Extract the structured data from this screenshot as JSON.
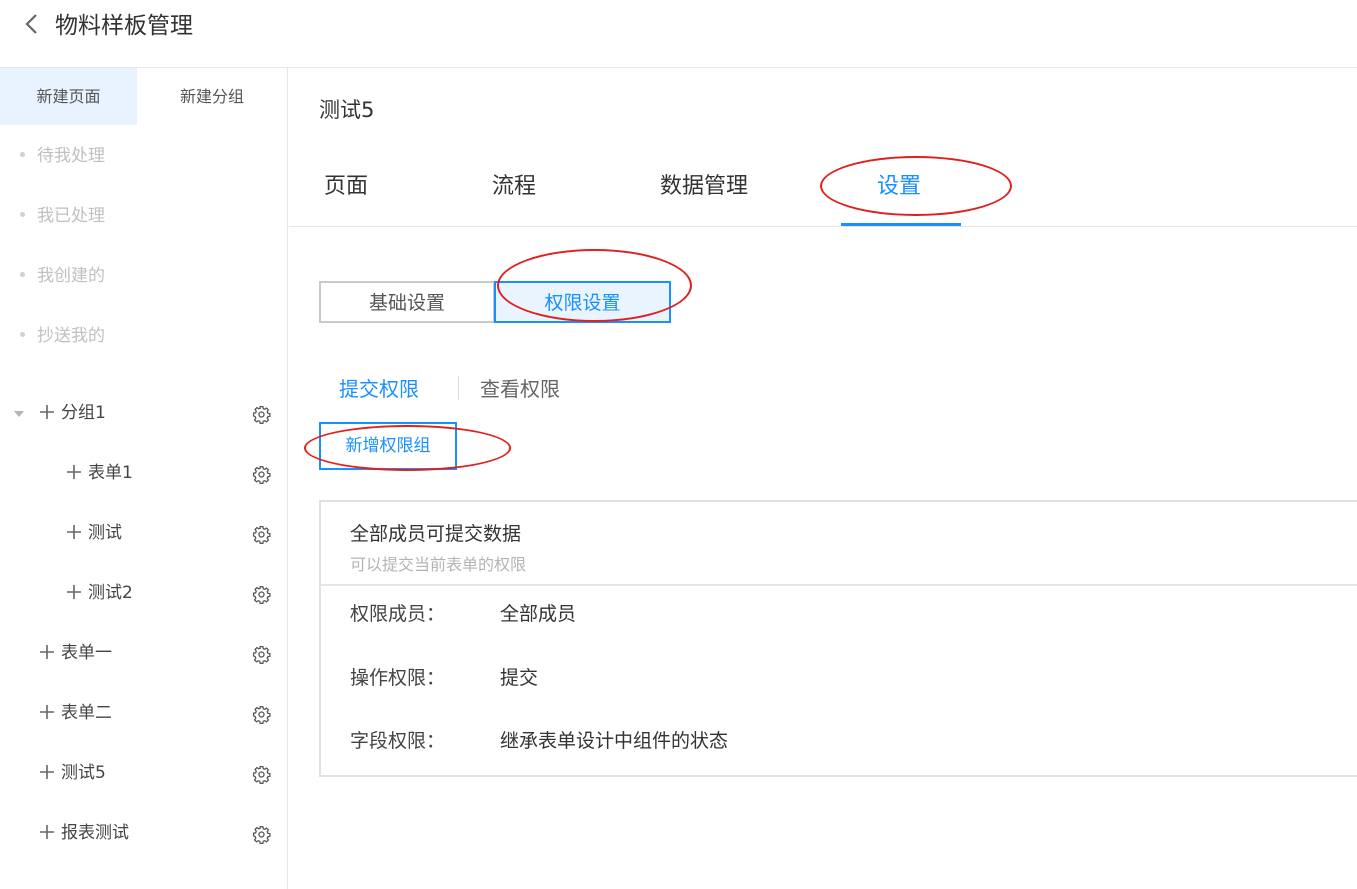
{
  "header": {
    "title": "物料样板管理",
    "back_icon": "chevron-left-icon"
  },
  "sidebar": {
    "tabs": [
      {
        "label": "新建页面",
        "active": true
      },
      {
        "label": "新建分组",
        "active": false
      }
    ],
    "quick_items": [
      "待我处理",
      "我已处理",
      "我创建的",
      "抄送我的"
    ],
    "tree": [
      {
        "label": "分组1",
        "level": 0,
        "expanded": true,
        "has_caret": true
      },
      {
        "label": "表单1",
        "level": 1
      },
      {
        "label": "测试",
        "level": 1
      },
      {
        "label": "测试2",
        "level": 1
      },
      {
        "label": "表单一",
        "level": 0
      },
      {
        "label": "表单二",
        "level": 0
      },
      {
        "label": "测试5",
        "level": 0
      },
      {
        "label": "报表测试",
        "level": 0
      }
    ]
  },
  "main": {
    "page_title": "测试5",
    "tabs": [
      {
        "label": "页面",
        "active": false
      },
      {
        "label": "流程",
        "active": false
      },
      {
        "label": "数据管理",
        "active": false
      },
      {
        "label": "设置",
        "active": true
      }
    ],
    "segments": [
      {
        "label": "基础设置",
        "active": false
      },
      {
        "label": "权限设置",
        "active": true
      }
    ],
    "sub_tabs": [
      {
        "label": "提交权限",
        "active": true
      },
      {
        "label": "查看权限",
        "active": false
      }
    ],
    "add_button": "新增权限组",
    "permission_card": {
      "title": "全部成员可提交数据",
      "description": "可以提交当前表单的权限",
      "rows": [
        {
          "label": "权限成员：",
          "value": "全部成员"
        },
        {
          "label": "操作权限：",
          "value": "提交"
        },
        {
          "label": "字段权限：",
          "value": "继承表单设计中组件的状态"
        }
      ]
    }
  },
  "colors": {
    "accent": "#1890ff",
    "annotation": "#e0201e",
    "active_tab_bg": "#e8f3ff"
  }
}
